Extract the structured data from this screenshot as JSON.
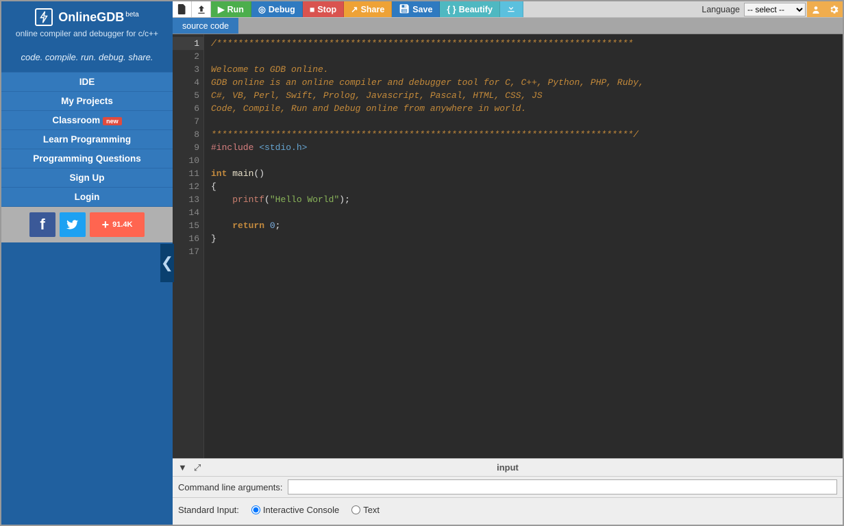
{
  "brand": {
    "name": "OnlineGDB",
    "beta": "beta",
    "subtitle": "online compiler and debugger for c/c++",
    "tagline": "code. compile. run. debug. share."
  },
  "nav": {
    "items": [
      {
        "label": "IDE",
        "new": false
      },
      {
        "label": "My Projects",
        "new": false
      },
      {
        "label": "Classroom",
        "new": true
      },
      {
        "label": "Learn Programming",
        "new": false
      },
      {
        "label": "Programming Questions",
        "new": false
      },
      {
        "label": "Sign Up",
        "new": false
      },
      {
        "label": "Login",
        "new": false
      }
    ],
    "new_label": "new",
    "share_count": "91.4K"
  },
  "toolbar": {
    "run": "Run",
    "debug": "Debug",
    "stop": "Stop",
    "share": "Share",
    "save": "Save",
    "beautify": "Beautify",
    "lang_label": "Language",
    "lang_value": "-- select --"
  },
  "tabs": {
    "active": "source code"
  },
  "code": {
    "line1": "/******************************************************************************",
    "line3": "Welcome to GDB online.",
    "line4": "GDB online is an online compiler and debugger tool for C, C++, Python, PHP, Ruby,",
    "line5": "C#, VB, Perl, Swift, Prolog, Javascript, Pascal, HTML, CSS, JS",
    "line6": "Code, Compile, Run and Debug online from anywhere in world.",
    "line8": "*******************************************************************************/",
    "include_kw": "#include",
    "include_hdr": "<stdio.h>",
    "int_kw": "int",
    "main_id": "main",
    "args": "()",
    "brace_open": "{",
    "brace_close": "}",
    "printf": "printf",
    "str": "\"Hello World\"",
    "semi": ");",
    "return_kw": "return",
    "zero": "0",
    "ret_semi": ";"
  },
  "bottom": {
    "title": "input",
    "cmdline_label": "Command line arguments:",
    "cmdline_value": "",
    "stdin_label": "Standard Input:",
    "opt_interactive": "Interactive Console",
    "opt_text": "Text"
  }
}
